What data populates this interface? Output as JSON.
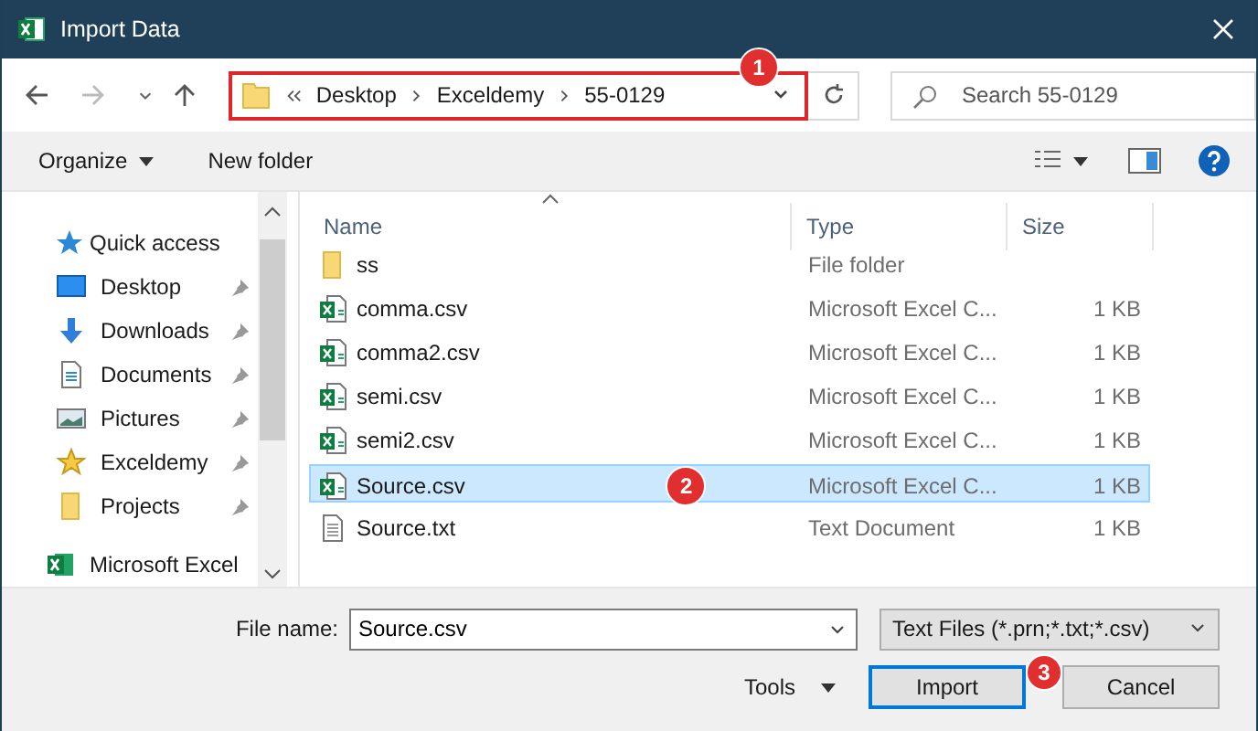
{
  "window": {
    "title": "Import Data"
  },
  "address_bar": {
    "crumbs": [
      "Desktop",
      "Exceldemy",
      "55-0129"
    ],
    "highlighted": true,
    "badge": "1"
  },
  "search": {
    "placeholder": "Search 55-0129"
  },
  "toolbar": {
    "organize": "Organize",
    "new_folder": "New folder"
  },
  "sidebar": {
    "items": [
      {
        "label": "Quick access",
        "kind": "quick",
        "pinned": false
      },
      {
        "label": "Desktop",
        "kind": "desktop",
        "pinned": true
      },
      {
        "label": "Downloads",
        "kind": "download",
        "pinned": true
      },
      {
        "label": "Documents",
        "kind": "document",
        "pinned": true
      },
      {
        "label": "Pictures",
        "kind": "picture",
        "pinned": true
      },
      {
        "label": "Exceldemy",
        "kind": "star",
        "pinned": true
      },
      {
        "label": "Projects",
        "kind": "folder",
        "pinned": true
      },
      {
        "label": "Microsoft Excel",
        "kind": "excel",
        "pinned": false
      }
    ]
  },
  "table": {
    "columns": [
      "Name",
      "Type",
      "Size"
    ],
    "rows": [
      {
        "name": "ss",
        "kind": "folder",
        "type": "File folder",
        "selected": false
      },
      {
        "name": "comma.csv",
        "kind": "csv",
        "type": "Microsoft Excel C...",
        "size": "1 KB",
        "selected": false
      },
      {
        "name": "comma2.csv",
        "kind": "csv",
        "type": "Microsoft Excel C...",
        "size": "1 KB",
        "selected": false
      },
      {
        "name": "semi.csv",
        "kind": "csv",
        "type": "Microsoft Excel C...",
        "size": "1 KB",
        "selected": false
      },
      {
        "name": "semi2.csv",
        "kind": "csv",
        "type": "Microsoft Excel C...",
        "size": "1 KB",
        "selected": false
      },
      {
        "name": "Source.csv",
        "kind": "csv",
        "type": "Microsoft Excel C...",
        "size": "1 KB",
        "selected": true,
        "badge": "2"
      },
      {
        "name": "Source.txt",
        "kind": "text",
        "type": "Text Document",
        "size": "1 KB",
        "selected": false
      }
    ]
  },
  "footer": {
    "file_name_label": "File name:",
    "file_name": "Source.csv",
    "file_type": "Text Files (*.prn;*.txt;*.csv)",
    "tools": "Tools",
    "import": "Import",
    "import_badge": "3",
    "cancel": "Cancel"
  }
}
